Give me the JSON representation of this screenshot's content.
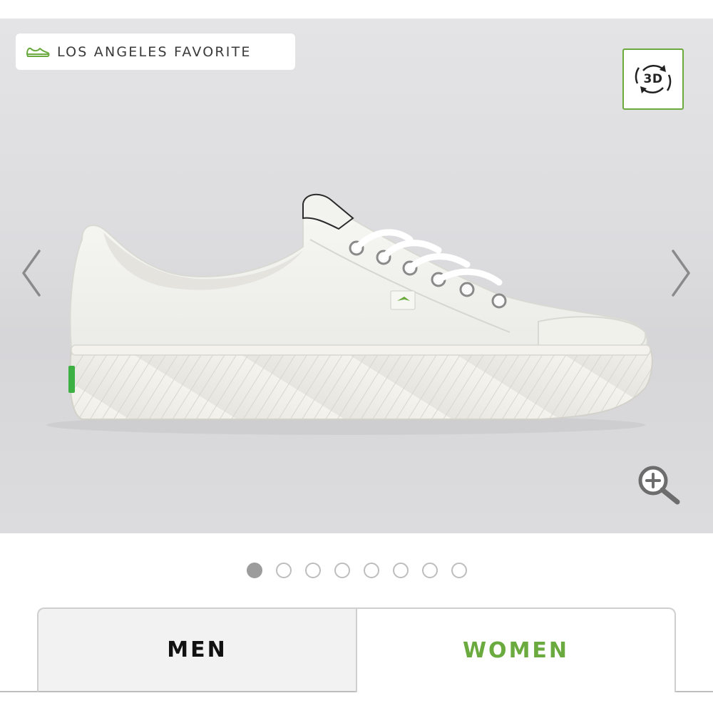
{
  "gallery": {
    "badge": {
      "icon": "sneaker-icon",
      "text": "LOS ANGELES FAVORITE"
    },
    "view_3d": {
      "label": "3D",
      "icon": "rotate-3d-icon"
    },
    "prev_icon": "chevron-left-icon",
    "next_icon": "chevron-right-icon",
    "zoom_icon": "zoom-in-icon",
    "image": "white-canvas-sneaker-side-view"
  },
  "pagination": {
    "total": 8,
    "active_index": 0
  },
  "gender_tabs": [
    {
      "label": "MEN",
      "selected": false
    },
    {
      "label": "WOMEN",
      "selected": true
    }
  ],
  "colors": {
    "accent_green": "#6aaa3e",
    "tab_inactive_bg": "#f2f2f2",
    "gallery_bg": "#dcdcdf"
  }
}
